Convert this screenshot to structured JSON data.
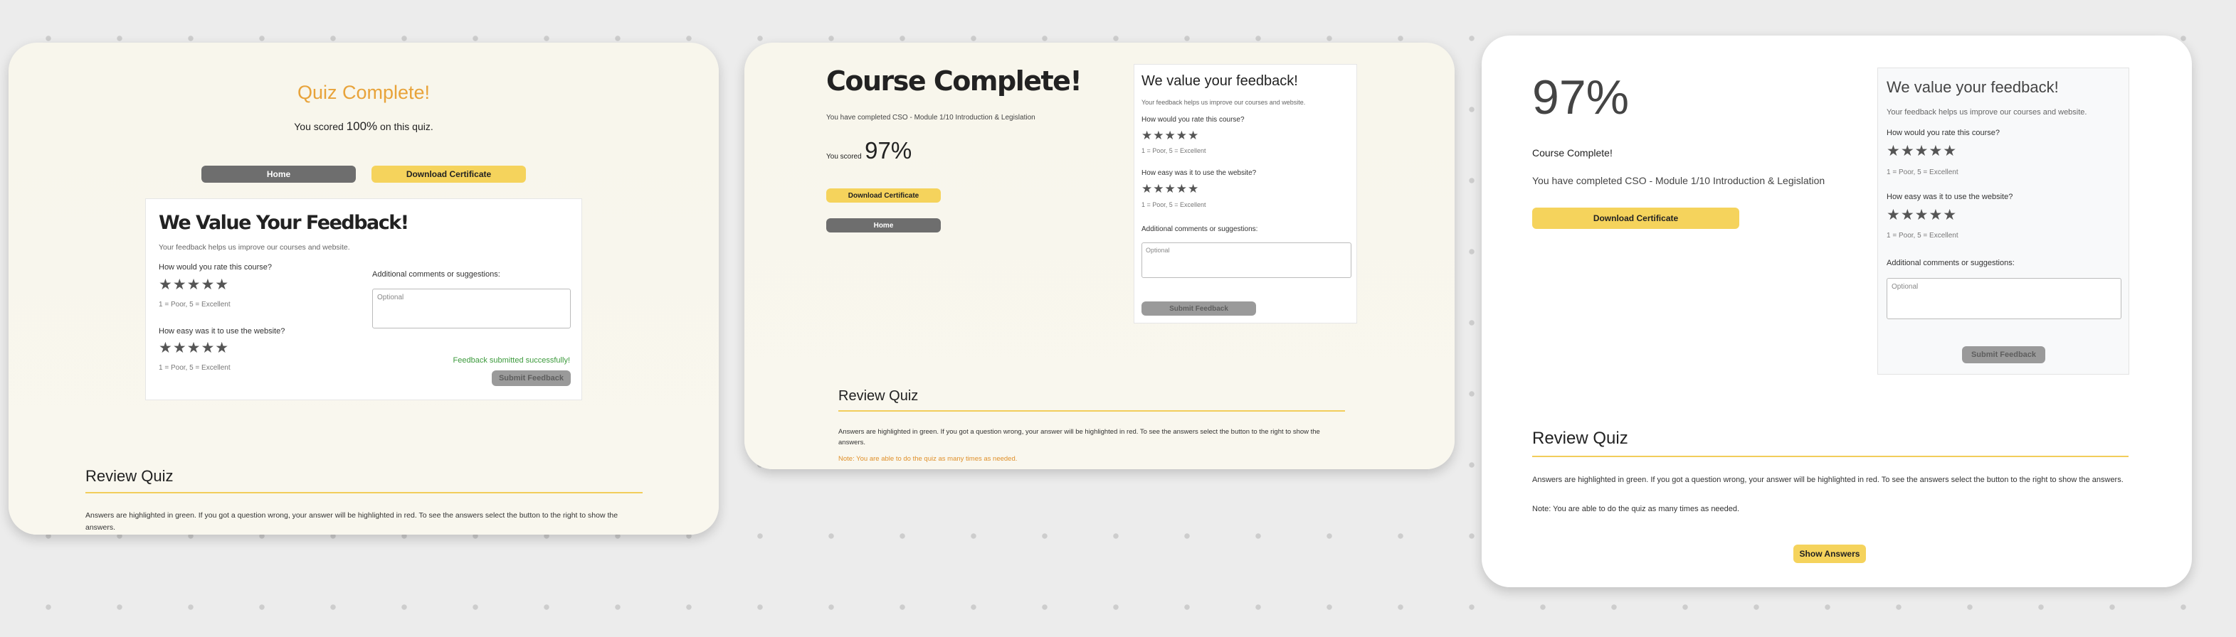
{
  "panel1": {
    "title": "Quiz Complete!",
    "score_prefix": "You scored",
    "score_value": "100%",
    "score_suffix": "on this quiz.",
    "home_button": "Home",
    "certificate_button": "Download Certificate",
    "feedback": {
      "title": "We Value Your Feedback!",
      "subtitle": "Your feedback helps us improve our courses and website.",
      "q1": "How would you rate this course?",
      "q1_stars": "★★★★★",
      "q1_scale": "1 = Poor, 5 = Excellent",
      "q2": "How easy was it to use the website?",
      "q2_stars": "★★★★★",
      "q2_scale": "1 = Poor, 5 = Excellent",
      "comments_label": "Additional comments or suggestions:",
      "comments_placeholder": "Optional",
      "success_message": "Feedback submitted successfully!",
      "submit_button": "Submit Feedback"
    },
    "review": {
      "title": "Review Quiz",
      "text": "Answers are highlighted in green. If you got a question wrong, your answer will be highlighted in red. To see the answers select the button to the right to show the answers."
    }
  },
  "panel2": {
    "title": "Course Complete!",
    "completed_text": "You have completed CSO - Module 1/10 Introduction & Legislation",
    "score_prefix": "You scored",
    "score_value": "97%",
    "certificate_button": "Download Certificate",
    "home_button": "Home",
    "feedback": {
      "title": "We value your feedback!",
      "subtitle": "Your feedback helps us improve our courses and website.",
      "q1": "How would you rate this course?",
      "q1_stars": "★★★★★",
      "q1_scale": "1 = Poor, 5 = Excellent",
      "q2": "How easy was it to use the website?",
      "q2_stars": "★★★★★",
      "q2_scale": "1 = Poor, 5 = Excellent",
      "comments_label": "Additional comments or suggestions:",
      "comments_placeholder": "Optional",
      "submit_button": "Submit Feedback"
    },
    "review": {
      "title": "Review Quiz",
      "text": "Answers are highlighted in green. If you got a question wrong, your answer will be highlighted in red. To see the answers select the button to the right to show the answers.",
      "note": "Note: You are able to do the quiz as many times as needed."
    }
  },
  "panel3": {
    "score_value": "97%",
    "course_complete": "Course Complete!",
    "completed_text": "You have completed CSO - Module 1/10 Introduction & Legislation",
    "certificate_button": "Download Certificate",
    "feedback": {
      "title": "We value your feedback!",
      "subtitle": "Your feedback helps us improve our courses and website.",
      "q1": "How would you rate this course?",
      "q1_stars": "★★★★★",
      "q1_scale": "1 = Poor, 5 = Excellent",
      "q2": "How easy was it to use the website?",
      "q2_stars": "★★★★★",
      "q2_scale": "1 = Poor, 5 = Excellent",
      "comments_label": "Additional comments or suggestions:",
      "comments_placeholder": "Optional",
      "submit_button": "Submit Feedback"
    },
    "review": {
      "title": "Review Quiz",
      "text": "Answers are highlighted in green. If you got a question wrong, your answer will be highlighted in red. To see the answers select the button to the right to show the answers.",
      "note": "Note: You are able to do the quiz as many times as needed."
    },
    "show_answers_button": "Show Answers"
  },
  "colors": {
    "accent_orange": "#e8a33a",
    "accent_yellow": "#f5d35c",
    "success_green": "#3c9a3c",
    "note_orange": "#e0902a",
    "button_gray": "#6e6e6e"
  }
}
